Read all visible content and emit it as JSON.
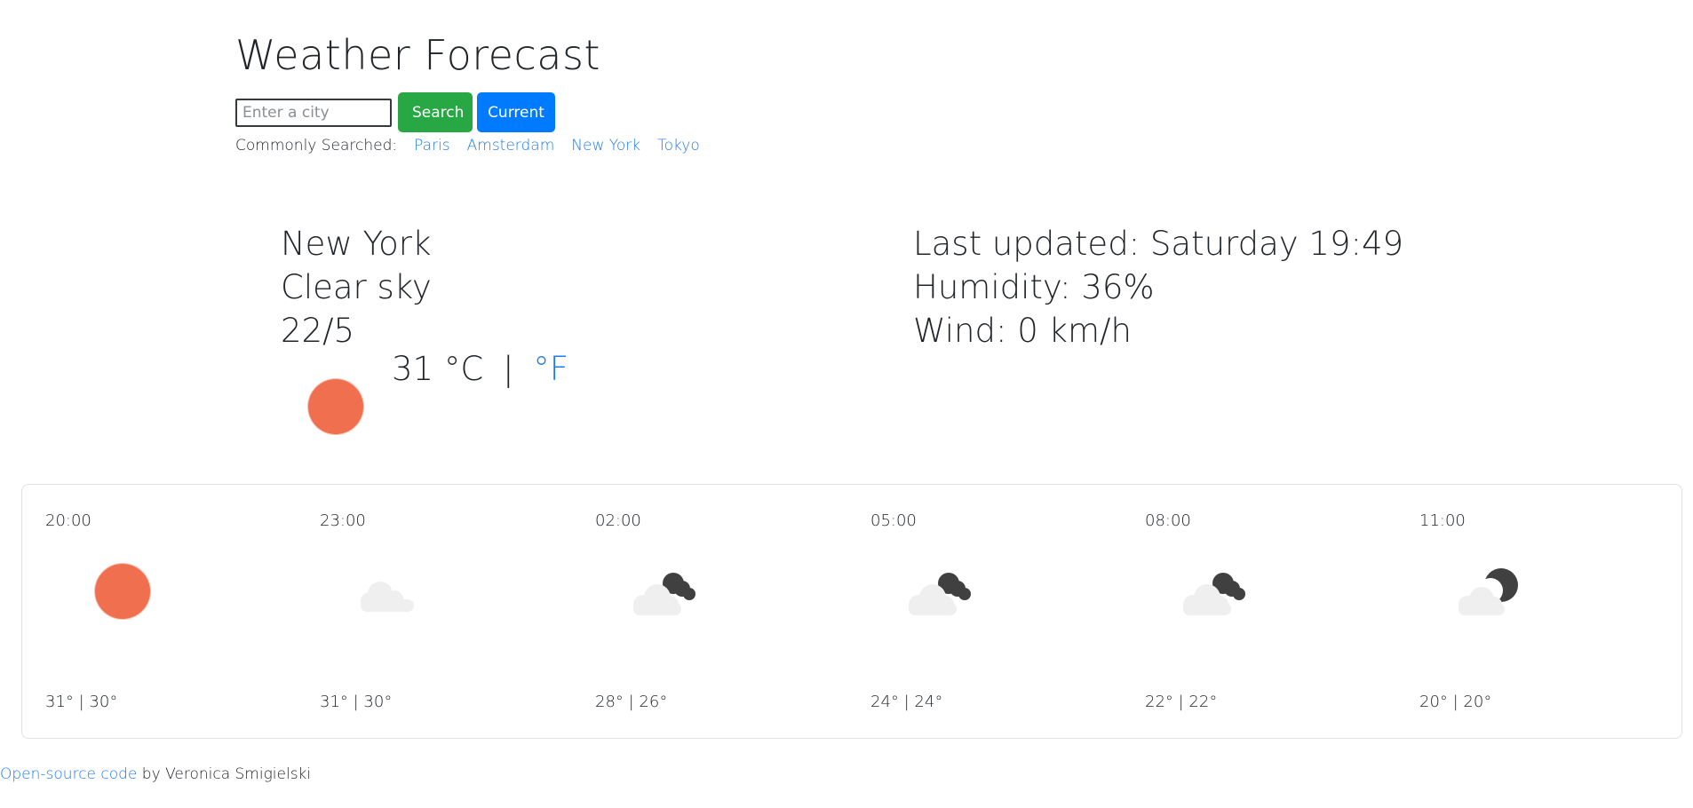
{
  "header": {
    "title": "Weather Forecast"
  },
  "search": {
    "placeholder": "Enter a city",
    "search_label": "Search",
    "current_label": "Current"
  },
  "common": {
    "label": "Commonly Searched:",
    "cities": [
      "Paris",
      "Amsterdam",
      "New York",
      "Tokyo"
    ]
  },
  "current": {
    "city": "New York",
    "description": "Clear sky",
    "date": "22/5",
    "temperature": "31",
    "unit_c": "°C",
    "separator": "|",
    "unit_f": "°F",
    "icon": "sun-icon",
    "last_updated": "Last updated: Saturday 19:49",
    "humidity": "Humidity: 36%",
    "wind": "Wind: 0 km/h"
  },
  "forecast": [
    {
      "time": "20:00",
      "temps": "31° | 30°",
      "icon": "sun-icon"
    },
    {
      "time": "23:00",
      "temps": "31° | 30°",
      "icon": "cloud-icon"
    },
    {
      "time": "02:00",
      "temps": "28° | 26°",
      "icon": "night-cloudy-icon"
    },
    {
      "time": "05:00",
      "temps": "24° | 24°",
      "icon": "night-cloudy-icon"
    },
    {
      "time": "08:00",
      "temps": "22° | 22°",
      "icon": "night-cloudy-icon"
    },
    {
      "time": "11:00",
      "temps": "20° | 20°",
      "icon": "moon-cloud-icon"
    }
  ],
  "footer": {
    "link_text": "Open-source code",
    "author_text": " by Veronica Smigielski"
  },
  "colors": {
    "sun": "#ef6f4f",
    "link": "#1e7bea",
    "search_button": "#28a745",
    "current_button": "#007bff",
    "cloud": "#efefef",
    "dark_cloud": "#404040"
  }
}
